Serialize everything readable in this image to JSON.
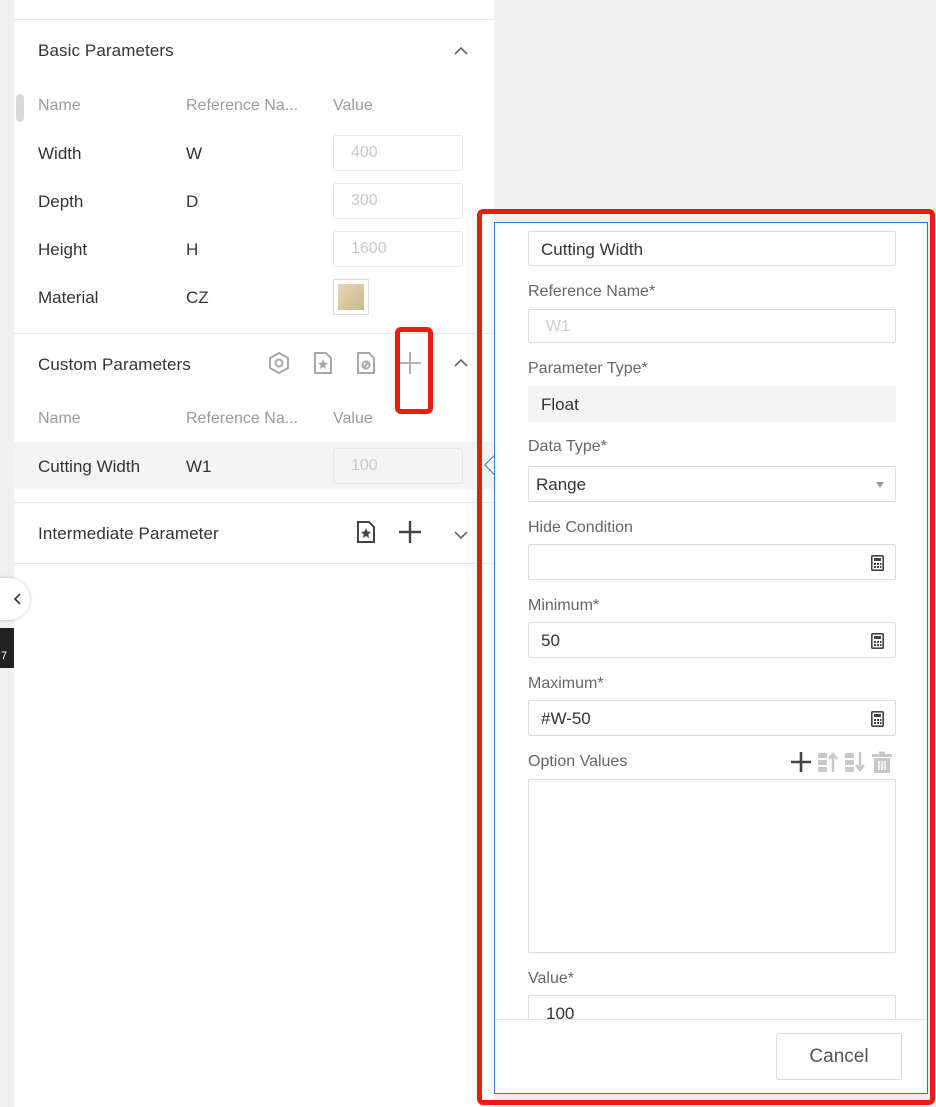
{
  "basic_section": {
    "title": "Basic Parameters",
    "headers": [
      "Name",
      "Reference Na...",
      "Value"
    ],
    "rows": [
      {
        "name": "Width",
        "ref": "W",
        "value": "400"
      },
      {
        "name": "Depth",
        "ref": "D",
        "value": "300"
      },
      {
        "name": "Height",
        "ref": "H",
        "value": "1600"
      },
      {
        "name": "Material",
        "ref": "CZ",
        "value": ""
      }
    ]
  },
  "custom_section": {
    "title": "Custom Parameters",
    "headers": [
      "Name",
      "Reference Na...",
      "Value"
    ],
    "rows": [
      {
        "name": "Cutting Width",
        "ref": "W1",
        "value": "100"
      }
    ]
  },
  "intermediate_section": {
    "title": "Intermediate Parameter"
  },
  "side_chip": "7",
  "editor": {
    "name_value": "Cutting Width",
    "reference_label": "Reference Name*",
    "reference_value": "W1",
    "type_label": "Parameter Type*",
    "type_value": "Float",
    "data_type_label": "Data Type*",
    "data_type_value": "Range",
    "hide_label": "Hide Condition",
    "hide_value": "",
    "min_label": "Minimum*",
    "min_value": "50",
    "max_label": "Maximum*",
    "max_value": "#W-50",
    "options_label": "Option Values",
    "value_label": "Value*",
    "value_value": "100",
    "cancel_label": "Cancel"
  },
  "colors": {
    "accent_blue": "#2e74c9",
    "annotation_red": "#ea1c0f"
  }
}
